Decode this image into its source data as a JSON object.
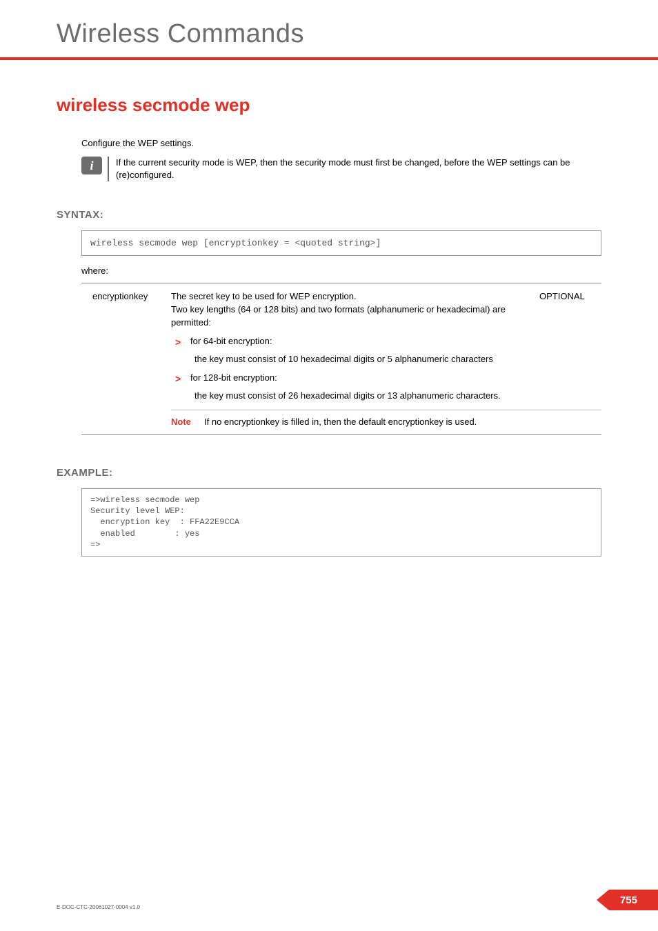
{
  "header": {
    "page_title": "Wireless Commands"
  },
  "command": {
    "title": "wireless secmode wep",
    "intro": "Configure the WEP settings.",
    "info_note": "If the current security mode is WEP, then the security mode must first be changed, before the WEP settings can be (re)configured."
  },
  "syntax": {
    "heading": "SYNTAX:",
    "command_line": "wireless secmode wep     [encryptionkey = <quoted string>]",
    "where_label": "where:",
    "param": {
      "name": "encryptionkey",
      "description": "The secret key to be used for WEP encryption.\nTwo key lengths (64 or 128 bits) and two formats (alphanumeric or hexadecimal) are permitted:",
      "optional_label": "OPTIONAL",
      "bullets": [
        {
          "title": "for 64-bit encryption:",
          "detail": "the key must consist of 10 hexadecimal digits or 5 alphanumeric characters"
        },
        {
          "title": "for 128-bit encryption:",
          "detail": "the key must consist of 26 hexadecimal digits or 13 alphanumeric characters."
        }
      ],
      "note_label": "Note",
      "note_text": "If no encryptionkey is filled in, then the default encryptionkey is used."
    }
  },
  "example": {
    "heading": "EXAMPLE:",
    "code": "=>wireless secmode wep\nSecurity level WEP:\n  encryption key  : FFA22E9CCA\n  enabled        : yes\n=>"
  },
  "footer": {
    "doc_id": "E-DOC-CTC-20061027-0004 v1.0",
    "page_number": "755"
  }
}
